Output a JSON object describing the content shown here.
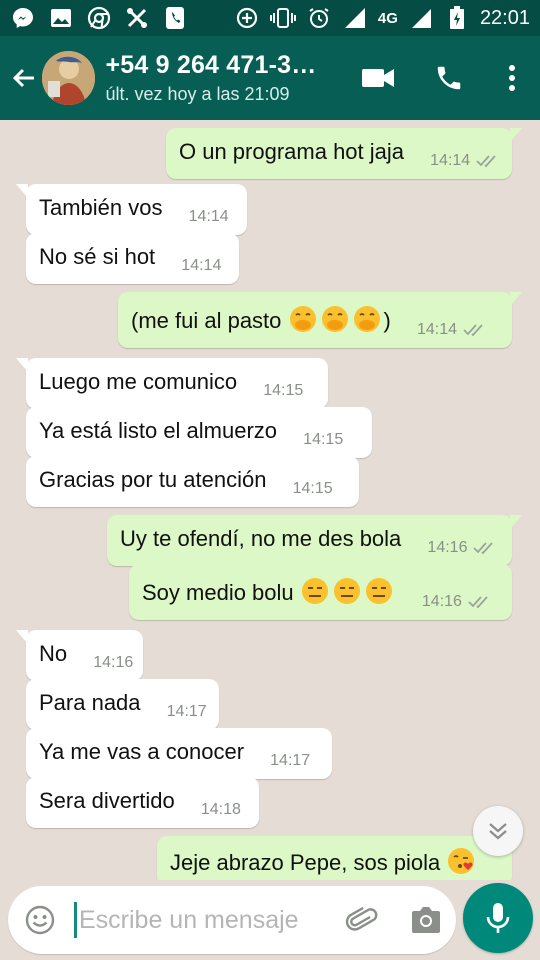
{
  "status_bar": {
    "time": "22:01",
    "network": "4G",
    "icons": [
      "messenger-icon",
      "gallery-icon",
      "chrome-icon",
      "tools-icon",
      "phone-app-icon",
      "data-saver-icon",
      "vibrate-icon",
      "alarm-icon",
      "signal-icon",
      "battery-charging-icon"
    ]
  },
  "header": {
    "contact_name": "+54 9 264 471-3…",
    "contact_status": "últ. vez hoy a las 21:09",
    "accent_color": "#075e54"
  },
  "messages": [
    {
      "direction": "out",
      "text": "O un programa hot jaja",
      "time": "14:14",
      "read": true,
      "emoji": []
    },
    {
      "direction": "in",
      "text": "También vos",
      "time": "14:14",
      "emoji": []
    },
    {
      "direction": "in",
      "text": "No sé si hot",
      "time": "14:14",
      "emoji": []
    },
    {
      "direction": "out",
      "text": "(me fui al pasto",
      "text_after": ")",
      "time": "14:14",
      "read": true,
      "emoji": [
        "hand-over-mouth",
        "hand-over-mouth",
        "hand-over-mouth"
      ]
    },
    {
      "direction": "in",
      "text": "Luego me comunico",
      "time": "14:15",
      "emoji": []
    },
    {
      "direction": "in",
      "text": "Ya está listo el almuerzo",
      "time": "14:15",
      "emoji": []
    },
    {
      "direction": "in",
      "text": "Gracias por tu atención",
      "time": "14:15",
      "emoji": []
    },
    {
      "direction": "out",
      "text": "Uy te ofendí, no me des bola",
      "time": "14:16",
      "read": true,
      "emoji": []
    },
    {
      "direction": "out",
      "text": "Soy medio bolu",
      "time": "14:16",
      "read": true,
      "emoji": [
        "expressionless",
        "expressionless",
        "expressionless"
      ]
    },
    {
      "direction": "in",
      "text": "No",
      "time": "14:16",
      "emoji": []
    },
    {
      "direction": "in",
      "text": "Para nada",
      "time": "14:17",
      "emoji": []
    },
    {
      "direction": "in",
      "text": "Ya me vas a conocer",
      "time": "14:17",
      "emoji": []
    },
    {
      "direction": "in",
      "text": "Sera divertido",
      "time": "14:18",
      "emoji": []
    },
    {
      "direction": "out",
      "text": "Jeje abrazo Pepe, sos piola",
      "time": "",
      "emoji": [
        "kissing-heart"
      ]
    }
  ],
  "input": {
    "placeholder": "Escribe un mensaje",
    "value": ""
  },
  "colors": {
    "outgoing_bubble": "#dcf8c6",
    "incoming_bubble": "#ffffff",
    "chat_background": "#e5ddd5",
    "mic_button": "#00897b"
  }
}
